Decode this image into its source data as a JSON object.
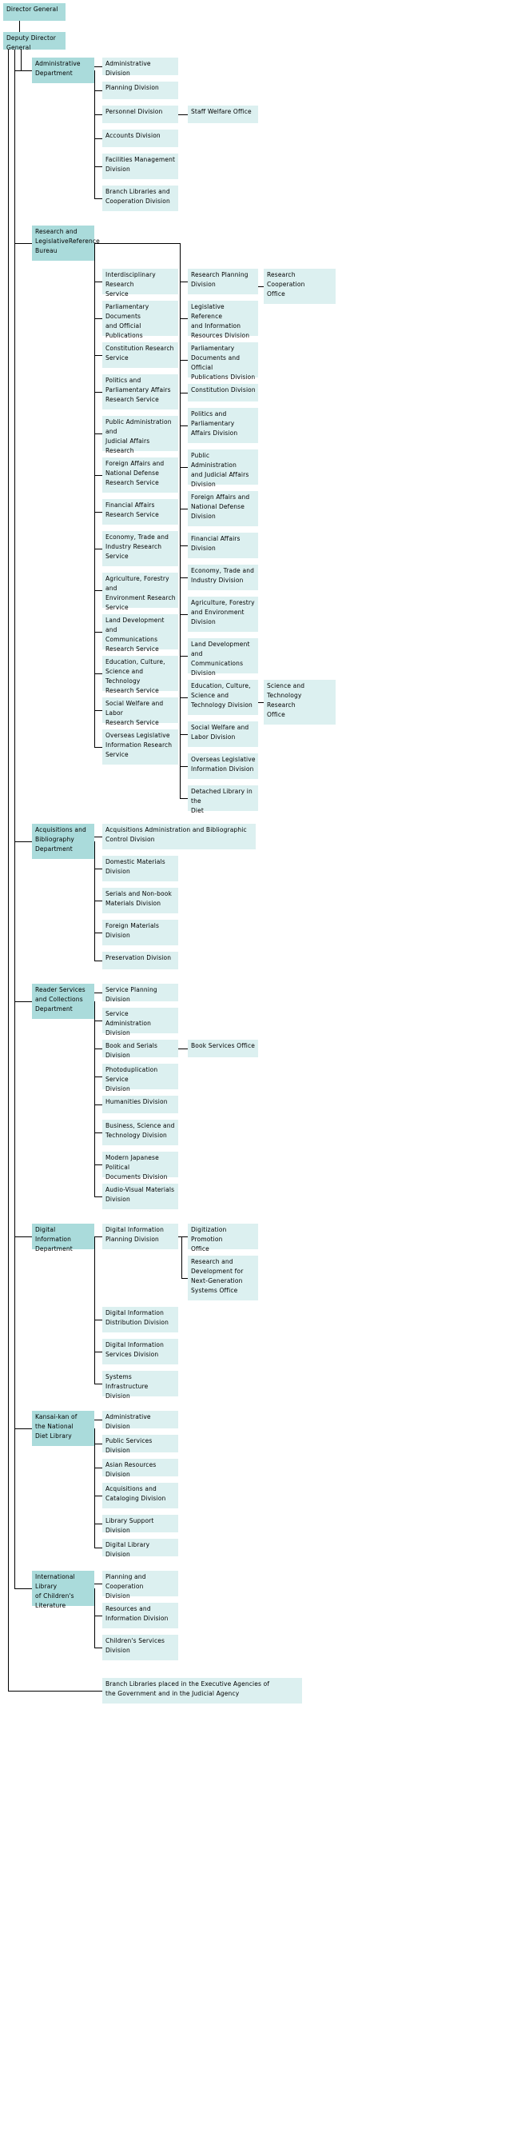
{
  "title": "National Diet Library Organization Chart",
  "colors": {
    "top_level": "#aadbdb",
    "department": "#aadbdb",
    "division": "#dcf0f0",
    "line": "#000000",
    "background": "#ffffff"
  },
  "org": {
    "director_general": "Director General",
    "deputy_director_general": "Deputy Director General",
    "departments": [
      {
        "name": "Administrative\nDepartment",
        "divisions": [
          {
            "name": "Administrative Division",
            "offices": []
          },
          {
            "name": "Planning Division",
            "offices": []
          },
          {
            "name": "Personnel Division",
            "offices": [
              "Staff Welfare Office"
            ]
          },
          {
            "name": "Accounts Division",
            "offices": []
          },
          {
            "name": "Facilities Management\nDivision",
            "offices": []
          },
          {
            "name": "Branch Libraries and\nCooperation Division",
            "offices": []
          }
        ]
      },
      {
        "name": "Research and\nLegislativeReference\nBureau",
        "services": [
          {
            "name": "Interdisciplinary Research\nService"
          },
          {
            "name": "Parliamentary Documents\nand Official Publications\nResearch Service"
          },
          {
            "name": "Constitution Research\nService"
          },
          {
            "name": "Politics and\nParliamentary Affairs\nResearch Service"
          },
          {
            "name": "Public Administration and\nJudicial Affairs Research\nService"
          },
          {
            "name": "Foreign Affairs and\nNational Defense\nResearch Service"
          },
          {
            "name": "Financial Affairs\nResearch Service"
          },
          {
            "name": "Economy, Trade and\nIndustry Research\nService"
          },
          {
            "name": "Agriculture, Forestry and\nEnvironment Research\nService"
          },
          {
            "name": "Land Development and\nCommunications\nResearch Service"
          },
          {
            "name": "Education, Culture,\nScience and Technology\nResearch Service"
          },
          {
            "name": "Social Welfare and Labor\nResearch Service"
          },
          {
            "name": "Overseas Legislative\nInformation Research\nService"
          }
        ],
        "divisions": [
          {
            "name": "Research Planning\nDivision",
            "offices": [
              "Research\nCooperation\nOffice"
            ]
          },
          {
            "name": "Legislative Reference\nand Information\nResources Division",
            "offices": []
          },
          {
            "name": "Parliamentary\nDocuments and Official\nPublications Division",
            "offices": []
          },
          {
            "name": "Constitution Division",
            "offices": []
          },
          {
            "name": "Politics and\nParliamentary\nAffairs Division",
            "offices": []
          },
          {
            "name": "Public Administration\nand Judicial Affairs\nDivision",
            "offices": []
          },
          {
            "name": "Foreign Affairs and\nNational Defense\nDivision",
            "offices": []
          },
          {
            "name": "Financial Affairs\nDivision",
            "offices": []
          },
          {
            "name": "Economy, Trade and\nIndustry Division",
            "offices": []
          },
          {
            "name": "Agriculture, Forestry\nand Environment\nDivision",
            "offices": []
          },
          {
            "name": "Land Development and\nCommunications\nDivision",
            "offices": []
          },
          {
            "name": "Education, Culture,\nScience and\nTechnology Division",
            "offices": [
              "Science and\nTechnology\nResearch\nOffice"
            ]
          },
          {
            "name": "Social Welfare and\nLabor Division",
            "offices": []
          },
          {
            "name": "Overseas Legislative\nInformation Division",
            "offices": []
          },
          {
            "name": "Detached Library in the\nDiet",
            "offices": []
          }
        ]
      },
      {
        "name": "Acquisitions and\nBibliography\nDepartment",
        "divisions": [
          {
            "name": "Acquisitions Administration and Bibliographic\nControl Division",
            "offices": []
          },
          {
            "name": "Domestic Materials\nDivision",
            "offices": []
          },
          {
            "name": "Serials and Non-book\nMaterials Division",
            "offices": []
          },
          {
            "name": "Foreign Materials\nDivision",
            "offices": []
          },
          {
            "name": "Preservation Division",
            "offices": []
          }
        ]
      },
      {
        "name": "Reader Services\n and Collections\nDepartment",
        "divisions": [
          {
            "name": "Service Planning Division",
            "offices": []
          },
          {
            "name": "Service Administration\nDivision",
            "offices": []
          },
          {
            "name": "Book and Serials Division",
            "offices": [
              "Book Services Office"
            ]
          },
          {
            "name": "Photoduplication Service\nDivision",
            "offices": []
          },
          {
            "name": "Humanities Division",
            "offices": []
          },
          {
            "name": "Business, Science and\nTechnology Division",
            "offices": []
          },
          {
            "name": "Modern Japanese Political\nDocuments Division",
            "offices": []
          },
          {
            "name": "Audio-Visual Materials\nDivision",
            "offices": []
          }
        ]
      },
      {
        "name": "Digital Information\nDepartment",
        "divisions": [
          {
            "name": "Digital Information\nPlanning Division",
            "offices": [
              "Digitization Promotion\nOffice",
              "Research and\nDevelopment for\nNext-Generation\nSystems Office"
            ]
          },
          {
            "name": "Digital Information\nDistribution Division",
            "offices": []
          },
          {
            "name": "Digital Information\nServices Division",
            "offices": []
          },
          {
            "name": "Systems Infrastructure\nDivision",
            "offices": []
          }
        ]
      },
      {
        "name": "Kansai-kan of\nthe National\nDiet Library",
        "divisions": [
          {
            "name": "Administrative Division",
            "offices": []
          },
          {
            "name": "Public Services Division",
            "offices": []
          },
          {
            "name": "Asian Resources Division",
            "offices": []
          },
          {
            "name": "Acquisitions and\nCataloging Division",
            "offices": []
          },
          {
            "name": "Library Support Division",
            "offices": []
          },
          {
            "name": "Digital Library Division",
            "offices": []
          }
        ]
      },
      {
        "name": "International Library\nof Children's\nLiterature",
        "divisions": [
          {
            "name": "Planning and Cooperation\nDivision",
            "offices": []
          },
          {
            "name": "Resources and\nInformation Division",
            "offices": []
          },
          {
            "name": "Children's Services\nDivision",
            "offices": []
          }
        ]
      }
    ],
    "footer": "Branch Libraries placed in the Executive Agencies of\nthe Government and in the Judicial Agency"
  }
}
